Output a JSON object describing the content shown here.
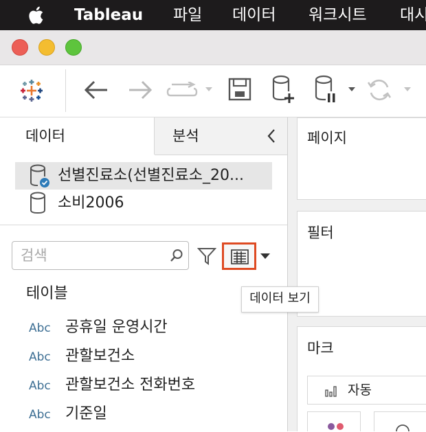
{
  "menubar": {
    "app_name": "Tableau",
    "items": [
      "파일",
      "데이터",
      "워크시트",
      "대시"
    ]
  },
  "toolbar": {
    "icons": [
      "tableau-logo-icon",
      "back-arrow-icon",
      "forward-arrow-icon",
      "redo-icon",
      "save-icon",
      "new-data-source-icon",
      "pause-updates-icon",
      "refresh-icon"
    ]
  },
  "data_pane": {
    "tabs": {
      "data": "데이터",
      "analysis": "분석"
    },
    "data_sources": [
      {
        "name": "선별진료소(선별진료소_20...",
        "active": true
      },
      {
        "name": "소비2006",
        "active": false
      }
    ],
    "search": {
      "placeholder": "검색",
      "value": ""
    },
    "tooltip": "데이터 보기",
    "tables_heading": "테이블",
    "fields": [
      {
        "type": "Abc",
        "name": "공휴일 운영시간"
      },
      {
        "type": "Abc",
        "name": "관할보건소"
      },
      {
        "type": "Abc",
        "name": "관할보건소 전화번호"
      },
      {
        "type": "Abc",
        "name": "기준일"
      }
    ]
  },
  "shelves": {
    "pages": "페이지",
    "filters": "필터",
    "marks": "마크",
    "marks_type": "자동"
  },
  "colors": {
    "menubar_bg": "#1d1b1c",
    "highlight_border": "#de4a22",
    "field_type_blue": "#3c6e93"
  }
}
